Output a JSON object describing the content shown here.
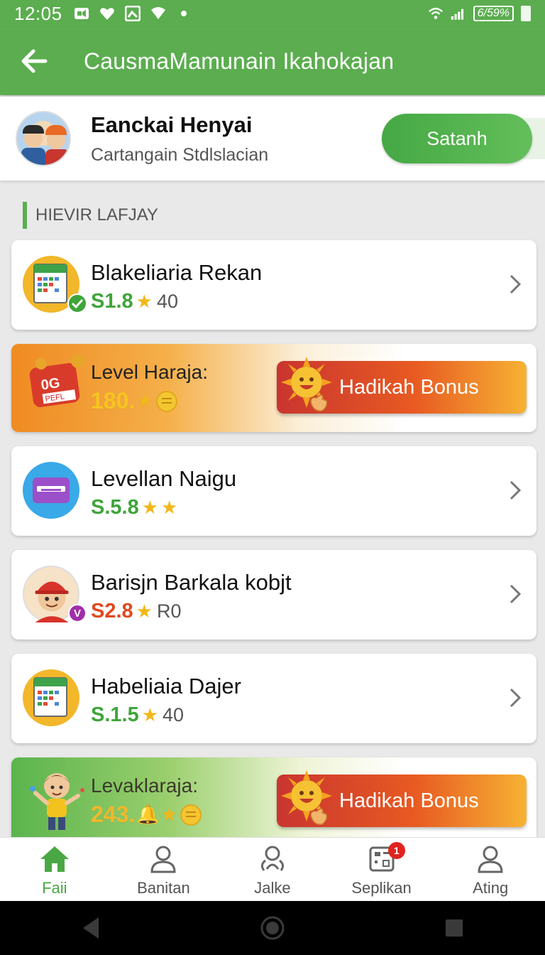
{
  "status_bar": {
    "time": "12:05",
    "battery_text": "6/59%"
  },
  "app_bar": {
    "title": "CausmaMamunain Ikahokajan"
  },
  "profile": {
    "name": "Eanckai Henyai",
    "subtitle": "Cartangain Stdlslacian",
    "button_label": "Satanh"
  },
  "section": {
    "title": "HIEVIR LAFJAY"
  },
  "items": [
    {
      "title": "Blakeliaria Rekan",
      "price": "S1.8",
      "count": "40",
      "icon": "calendar-sheet-icon",
      "badge_icon": "check-badge-icon"
    },
    {
      "title": "Levellan Naigu",
      "price": "S.5.8",
      "count": "",
      "icon": "ticket-icon"
    },
    {
      "title": "Barisjn Barkala kobjt",
      "price": "S2.8",
      "count": "R0",
      "icon": "worker-avatar-icon",
      "badge_text": "V"
    },
    {
      "title": "Habeliaia Dajer",
      "price": "S.1.5",
      "count": "40",
      "icon": "calendar-sheet-icon"
    }
  ],
  "banners": [
    {
      "label": "Level Haraja:",
      "value": "180.",
      "button": "Hadikah Bonus",
      "icon_text_top": "0G",
      "icon_text_bottom": "PEFL"
    },
    {
      "label": "Levaklaraja:",
      "value": "243.",
      "button": "Hadikah Bonus"
    }
  ],
  "bottom_nav": [
    {
      "label": "Faii",
      "icon": "home-icon",
      "active": true
    },
    {
      "label": "Banitan",
      "icon": "person-icon",
      "active": false
    },
    {
      "label": "Jalke",
      "icon": "people-icon",
      "active": false
    },
    {
      "label": "Seplikan",
      "icon": "board-icon",
      "active": false,
      "badge": "1"
    },
    {
      "label": "Ating",
      "icon": "account-icon",
      "active": false
    }
  ],
  "colors": {
    "primary_green": "#5bad4f",
    "price_green": "#3fa53a",
    "price_red": "#e04a1f",
    "bonus_red": "#c9352f",
    "bonus_orange": "#f6b233",
    "star_yellow": "#f1b81a"
  }
}
